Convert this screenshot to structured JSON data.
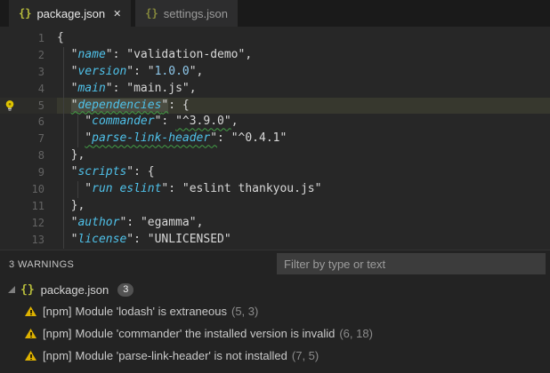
{
  "tabs": [
    {
      "label": "package.json",
      "icon_glyph": "{}",
      "close_glyph": "✕",
      "active": true
    },
    {
      "label": "settings.json",
      "icon_glyph": "{}",
      "active": false
    }
  ],
  "editor": {
    "colors": {
      "key": "#4fc1e9",
      "text": "#d8d8d8",
      "numeric": "#8fc9ec",
      "squiggle": "#43a047",
      "current_line": "#37382e"
    },
    "lines": [
      {
        "num": 1,
        "segments": [
          {
            "t": "{",
            "c": "p"
          }
        ]
      },
      {
        "num": 2,
        "segments": [
          {
            "t": "  \"",
            "c": "p"
          },
          {
            "t": "name",
            "c": "k"
          },
          {
            "t": "\": ",
            "c": "p"
          },
          {
            "t": "\"validation-demo\"",
            "c": "s"
          },
          {
            "t": ",",
            "c": "p"
          }
        ]
      },
      {
        "num": 3,
        "segments": [
          {
            "t": "  \"",
            "c": "p"
          },
          {
            "t": "version",
            "c": "k"
          },
          {
            "t": "\": \"",
            "c": "p"
          },
          {
            "t": "1.0.0",
            "c": "n"
          },
          {
            "t": "\",",
            "c": "p"
          }
        ]
      },
      {
        "num": 4,
        "segments": [
          {
            "t": "  \"",
            "c": "p"
          },
          {
            "t": "main",
            "c": "k"
          },
          {
            "t": "\": ",
            "c": "p"
          },
          {
            "t": "\"main.js\"",
            "c": "s"
          },
          {
            "t": ",",
            "c": "p"
          }
        ]
      },
      {
        "num": 5,
        "current": true,
        "bulb": true,
        "segments": [
          {
            "t": "  ",
            "c": "p"
          },
          {
            "t": "\"",
            "c": "p",
            "sq": true,
            "hl": true
          },
          {
            "t": "dependencies",
            "c": "k",
            "sq": true,
            "hl": true
          },
          {
            "t": "\"",
            "c": "p",
            "sq": true,
            "hl": true
          },
          {
            "t": ": {",
            "c": "p"
          }
        ]
      },
      {
        "num": 6,
        "segments": [
          {
            "t": "    \"",
            "c": "p"
          },
          {
            "t": "commander",
            "c": "k"
          },
          {
            "t": "\": ",
            "c": "p"
          },
          {
            "t": "\"^3.9.0\"",
            "c": "s",
            "sq": true
          },
          {
            "t": ",",
            "c": "p"
          }
        ]
      },
      {
        "num": 7,
        "segments": [
          {
            "t": "    ",
            "c": "p"
          },
          {
            "t": "\"",
            "c": "p",
            "sq": true
          },
          {
            "t": "parse-link-header",
            "c": "k",
            "sq": true
          },
          {
            "t": "\"",
            "c": "p",
            "sq": true
          },
          {
            "t": ": ",
            "c": "p"
          },
          {
            "t": "\"^0.4.1\"",
            "c": "s"
          }
        ]
      },
      {
        "num": 8,
        "segments": [
          {
            "t": "  },",
            "c": "p"
          }
        ]
      },
      {
        "num": 9,
        "segments": [
          {
            "t": "  \"",
            "c": "p"
          },
          {
            "t": "scripts",
            "c": "k"
          },
          {
            "t": "\": {",
            "c": "p"
          }
        ]
      },
      {
        "num": 10,
        "segments": [
          {
            "t": "    \"",
            "c": "p"
          },
          {
            "t": "run eslint",
            "c": "k"
          },
          {
            "t": "\": ",
            "c": "p"
          },
          {
            "t": "\"eslint thankyou.js\"",
            "c": "s"
          }
        ]
      },
      {
        "num": 11,
        "segments": [
          {
            "t": "  },",
            "c": "p"
          }
        ]
      },
      {
        "num": 12,
        "segments": [
          {
            "t": "  \"",
            "c": "p"
          },
          {
            "t": "author",
            "c": "k"
          },
          {
            "t": "\": ",
            "c": "p"
          },
          {
            "t": "\"egamma\"",
            "c": "s"
          },
          {
            "t": ",",
            "c": "p"
          }
        ]
      },
      {
        "num": 13,
        "segments": [
          {
            "t": "  \"",
            "c": "p"
          },
          {
            "t": "license",
            "c": "k"
          },
          {
            "t": "\": ",
            "c": "p"
          },
          {
            "t": "\"UNLICENSED\"",
            "c": "s"
          }
        ]
      }
    ]
  },
  "problems": {
    "summary": "3 WARNINGS",
    "filter_placeholder": "Filter by type or text",
    "group": {
      "icon_glyph": "{}",
      "filename": "package.json",
      "badge": "3"
    },
    "items": [
      {
        "source": "[npm]",
        "message": "Module 'lodash' is extraneous",
        "position": "(5, 3)"
      },
      {
        "source": "[npm]",
        "message": "Module 'commander' the installed version is invalid",
        "position": "(6, 18)"
      },
      {
        "source": "[npm]",
        "message": "Module 'parse-link-header' is not installed",
        "position": "(7, 5)"
      }
    ]
  },
  "icons": {
    "warning_color": "#deb200",
    "json_icon_color": "#b9be3c",
    "lightbulb_color": "#dfc400"
  }
}
